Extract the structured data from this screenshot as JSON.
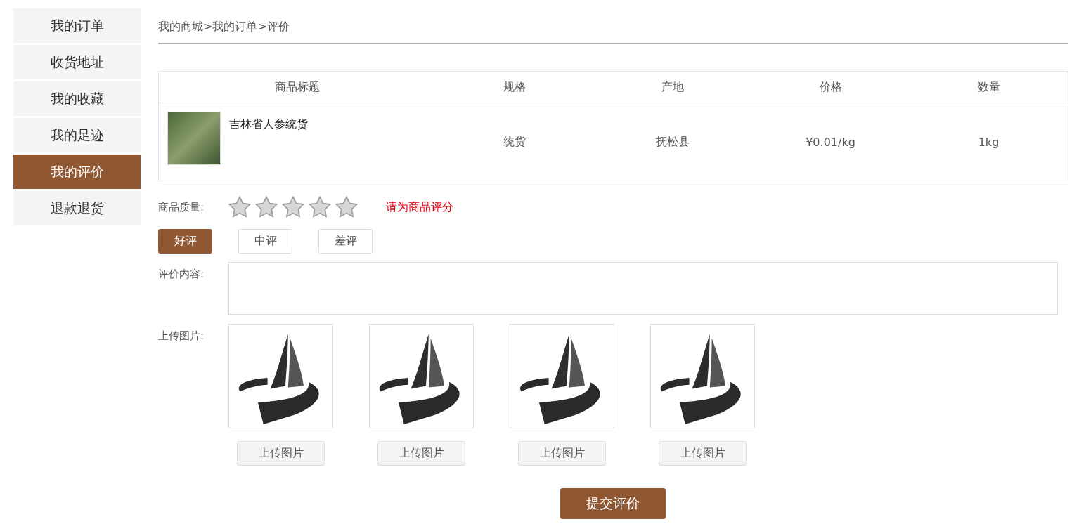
{
  "sidebar": {
    "items": [
      {
        "label": "我的订单",
        "selected": false
      },
      {
        "label": "收货地址",
        "selected": false
      },
      {
        "label": "我的收藏",
        "selected": false
      },
      {
        "label": "我的足迹",
        "selected": false
      },
      {
        "label": "我的评价",
        "selected": true
      },
      {
        "label": "退款退货",
        "selected": false
      }
    ]
  },
  "breadcrumb": "我的商城>我的订单>评价",
  "table": {
    "columns": [
      "商品标题",
      "规格",
      "产地",
      "价格",
      "数量"
    ],
    "rows": [
      {
        "title": "吉林省人参统货",
        "spec": "统货",
        "origin": "抚松县",
        "price": "¥0.01/kg",
        "quantity": "1kg"
      }
    ]
  },
  "rating": {
    "label": "商品质量:",
    "stars": 0,
    "hint": "请为商品评分"
  },
  "grades": [
    {
      "label": "好评",
      "selected": true
    },
    {
      "label": "中评",
      "selected": false
    },
    {
      "label": "差评",
      "selected": false
    }
  ],
  "content": {
    "label": "评价内容:"
  },
  "upload": {
    "label": "上传图片:",
    "slots": [
      {
        "button": "上传图片"
      },
      {
        "button": "上传图片"
      },
      {
        "button": "上传图片"
      },
      {
        "button": "上传图片"
      }
    ]
  },
  "submit": "提交评价"
}
